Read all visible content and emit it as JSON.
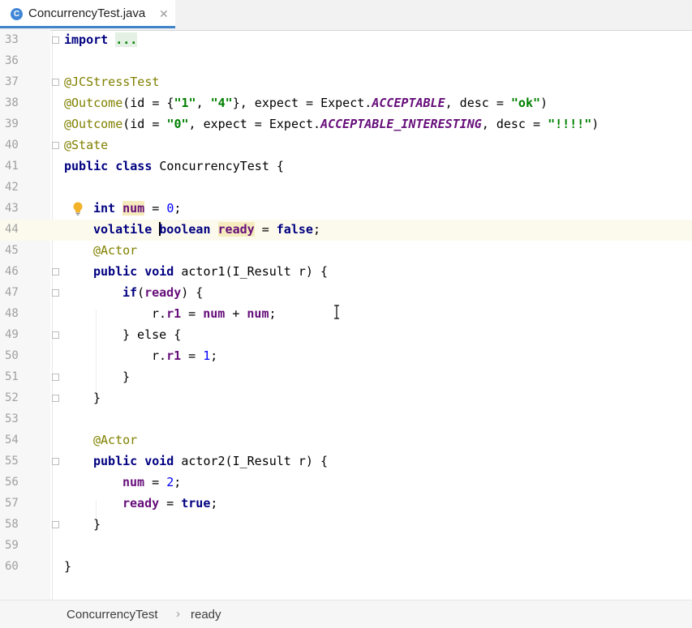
{
  "tab": {
    "title": "ConcurrencyTest.java",
    "icon": "java-class-icon",
    "icon_letter": "C",
    "close": "✕"
  },
  "lines": {
    "l33": "33",
    "l36": "36",
    "l37": "37",
    "l38": "38",
    "l39": "39",
    "l40": "40",
    "l41": "41",
    "l42": "42",
    "l43": "43",
    "l44": "44",
    "l45": "45",
    "l46": "46",
    "l47": "47",
    "l48": "48",
    "l49": "49",
    "l50": "50",
    "l51": "51",
    "l52": "52",
    "l53": "53",
    "l54": "54",
    "l55": "55",
    "l56": "56",
    "l57": "57",
    "l58": "58",
    "l59": "59",
    "l60": "60"
  },
  "code": {
    "import_kw": "import",
    "import_dots": "...",
    "jcstress": "@JCStressTest",
    "outcome": "@Outcome",
    "o1_a": "(id = {",
    "o1_s1": "\"1\"",
    "o1_comma": ", ",
    "o1_s2": "\"4\"",
    "o1_b": "}, expect = Expect.",
    "o1_c": "ACCEPTABLE",
    "o1_d": ", desc = ",
    "o1_s3": "\"ok\"",
    "o1_e": ")",
    "o2_a": "(id = ",
    "o2_s1": "\"0\"",
    "o2_b": ", expect = Expect.",
    "o2_c": "ACCEPTABLE_INTERESTING",
    "o2_d": ", desc = ",
    "o2_s2": "\"!!!!\"",
    "o2_e": ")",
    "state": "@State",
    "public": "public",
    "class": "class",
    "class_name": " ConcurrencyTest {",
    "int": "int",
    "num": "num",
    "eq": " = ",
    "zero": "0",
    "semi": ";",
    "volatile": "volatile",
    "boolean": "boolean",
    "ready": "ready",
    "false": "false",
    "actor": "@Actor",
    "void": "void",
    "actor1_sig": " actor1(I_Result r) {",
    "if": "if",
    "paren_open": "(",
    "if_tail": ") {",
    "r_dot": "r.",
    "r1": "r1",
    "plus": " + ",
    "else_line": "} else {",
    "one": "1",
    "close_brace": "}",
    "actor2_sig": " actor2(I_Result r) {",
    "two": "2",
    "true": "true"
  },
  "breadcrumb": {
    "class": "ConcurrencyTest",
    "separator": "›",
    "field": "ready"
  },
  "colors": {
    "keyword": "#000080",
    "annotation": "#808000",
    "string": "#008000",
    "number": "#0000ff",
    "field": "#660e7a",
    "current_line": "#fcfaed",
    "usage_highlight": "#f6ebbc"
  }
}
